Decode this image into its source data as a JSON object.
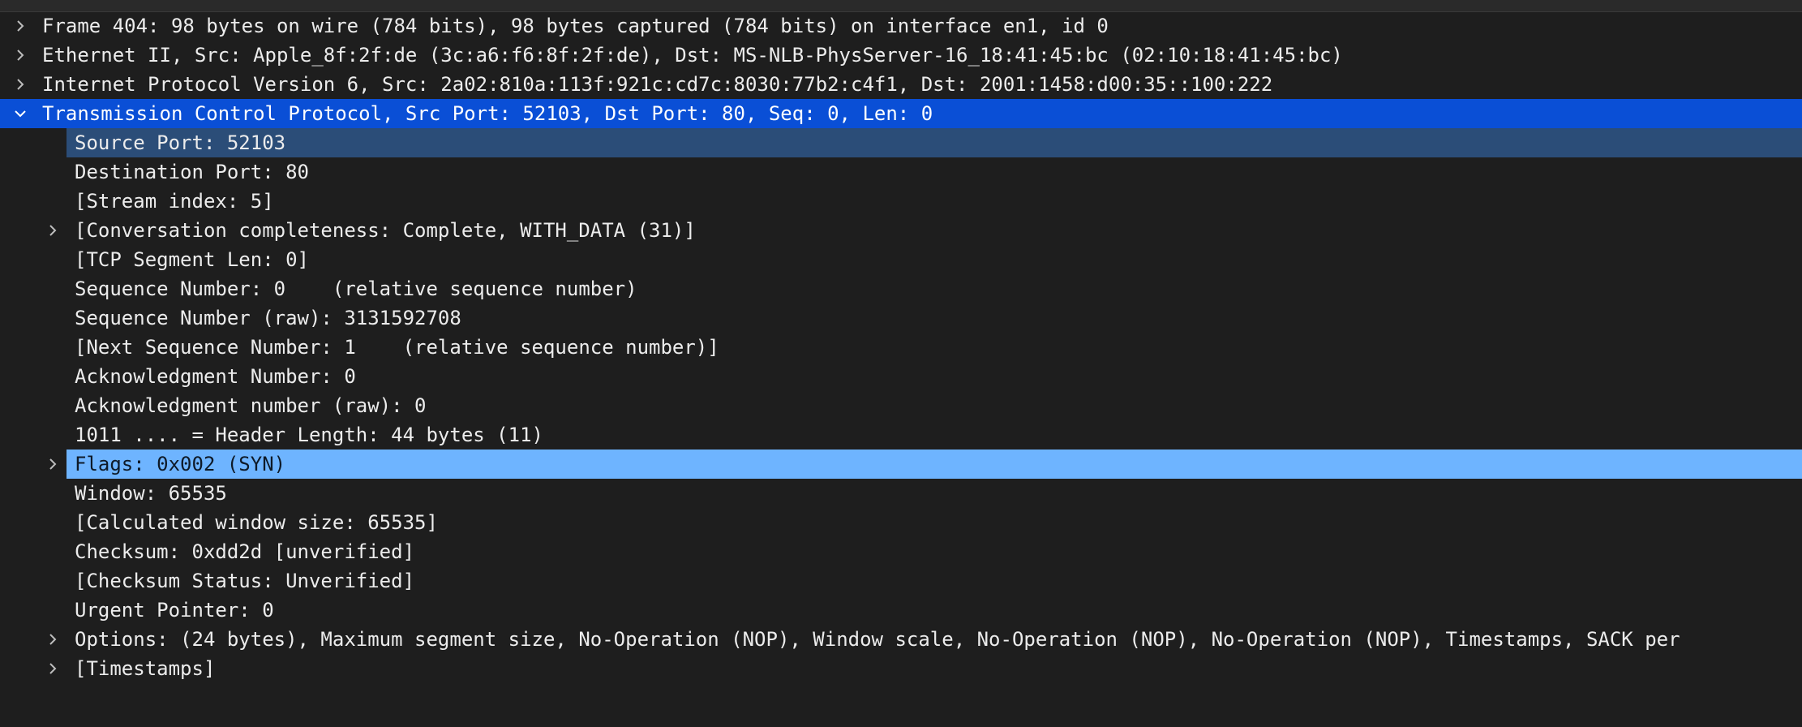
{
  "colors": {
    "background": "#1e1e1e",
    "text": "#ececec",
    "selected_row": "#0a4fd6",
    "selected_child": "#2b4d78",
    "flags_highlight": "#6eb4ff"
  },
  "tree": {
    "frame": "Frame 404: 98 bytes on wire (784 bits), 98 bytes captured (784 bits) on interface en1, id 0",
    "ethernet": "Ethernet II, Src: Apple_8f:2f:de (3c:a6:f6:8f:2f:de), Dst: MS-NLB-PhysServer-16_18:41:45:bc (02:10:18:41:45:bc)",
    "ipv6": "Internet Protocol Version 6, Src: 2a02:810a:113f:921c:cd7c:8030:77b2:c4f1, Dst: 2001:1458:d00:35::100:222",
    "tcp": "Transmission Control Protocol, Src Port: 52103, Dst Port: 80, Seq: 0, Len: 0",
    "source_port": "Source Port: 52103",
    "destination_port": "Destination Port: 80",
    "stream_index": "[Stream index: 5]",
    "conversation": "[Conversation completeness: Complete, WITH_DATA (31)]",
    "segment_len": "[TCP Segment Len: 0]",
    "seq_number": "Sequence Number: 0    (relative sequence number)",
    "seq_raw": "Sequence Number (raw): 3131592708",
    "next_seq": "[Next Sequence Number: 1    (relative sequence number)]",
    "ack_number": "Acknowledgment Number: 0",
    "ack_raw": "Acknowledgment number (raw): 0",
    "header_length": "1011 .... = Header Length: 44 bytes (11)",
    "flags": "Flags: 0x002 (SYN)",
    "window": "Window: 65535",
    "calc_window": "[Calculated window size: 65535]",
    "checksum": "Checksum: 0xdd2d [unverified]",
    "checksum_status": "[Checksum Status: Unverified]",
    "urgent_pointer": "Urgent Pointer: 0",
    "options": "Options: (24 bytes), Maximum segment size, No-Operation (NOP), Window scale, No-Operation (NOP), No-Operation (NOP), Timestamps, SACK per",
    "timestamps": "[Timestamps]"
  }
}
